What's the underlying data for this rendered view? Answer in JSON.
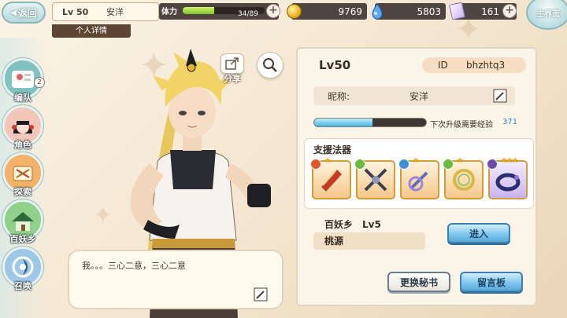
{
  "header": {
    "back_label": "返回",
    "player_level": "Lv 50",
    "player_name": "安洋",
    "detail_tab": "个人详情",
    "stamina_label": "体力",
    "stamina_text": "34/89",
    "stamina_ratio": 0.38,
    "coins": "9769",
    "jade": "5803",
    "cards": "161",
    "main_label": "主界面"
  },
  "sidebar": {
    "items": [
      {
        "label": "编队",
        "icon": "team-icon",
        "badge": "2"
      },
      {
        "label": "角色",
        "icon": "character-icon"
      },
      {
        "label": "探索",
        "icon": "explore-icon"
      },
      {
        "label": "百妖乡",
        "icon": "village-icon"
      },
      {
        "label": "召唤",
        "icon": "summon-icon"
      }
    ]
  },
  "actions": {
    "share_label": "分享"
  },
  "speech": {
    "text": "我。。。三心二意，三心二意"
  },
  "profile": {
    "level": "Lv50",
    "id_label": "ID",
    "id_value": "bhzhtq3",
    "nickname_label": "昵称:",
    "nickname": "安洋",
    "exp_ratio": 0.52,
    "exp_label": "下次升级需要经验",
    "exp_value": "371",
    "support_title": "支援法器",
    "support_items": [
      {
        "icon": "scroll-icon",
        "stars": 1,
        "element": "fire"
      },
      {
        "icon": "crossbow-icon",
        "stars": 0,
        "element": "wind"
      },
      {
        "icon": "sword-icon",
        "stars": 1,
        "element": "water"
      },
      {
        "icon": "wreath-icon",
        "stars": 1,
        "element": "wind"
      },
      {
        "icon": "bracelet-icon",
        "stars": 3,
        "element": "dark"
      }
    ],
    "village_name": "百妖乡",
    "village_level": "Lv5",
    "village_sub": "桃源",
    "enter_label": "进入",
    "change_secretary_label": "更换秘书",
    "message_board_label": "留言板"
  },
  "colors": {
    "accent_blue": "#5aa9d8",
    "exp_fill": "#45b3e0",
    "stamina_fill": "#7fc232",
    "panel_bg": "#fbf4e8"
  }
}
